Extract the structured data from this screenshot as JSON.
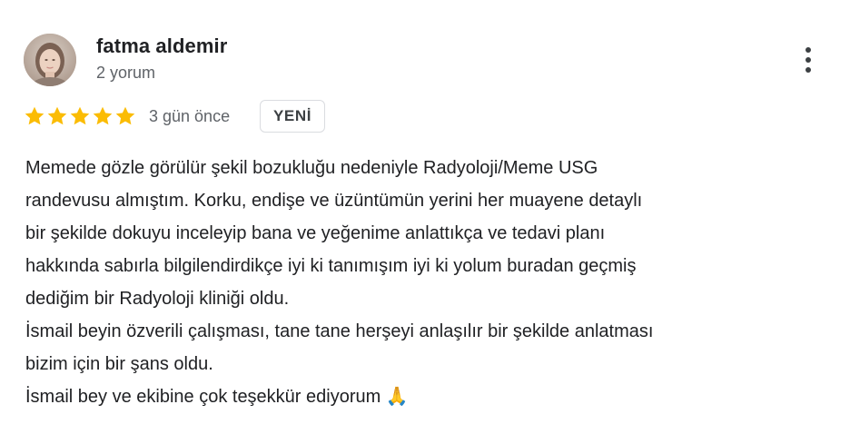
{
  "reviewer": {
    "name": "fatma aldemir",
    "review_count": "2 yorum"
  },
  "rating": {
    "stars": 5,
    "max_stars": 5,
    "star_color": "#fbbc04",
    "date": "3 gün önce",
    "badge": "YENİ"
  },
  "review": {
    "lines": [
      "Memede gözle görülür şekil bozukluğu nedeniyle Radyoloji/Meme USG",
      "randevusu almıştım. Korku, endişe ve üzüntümün yerini her muayene detaylı",
      "bir şekilde dokuyu inceleyip bana ve yeğenime anlattıkça ve tedavi planı",
      "hakkında sabırla bilgilendirdikçe iyi ki tanımışım iyi ki yolum buradan geçmiş",
      "dediğim bir Radyoloji kliniği oldu.",
      "İsmail beyin özverili çalışması, tane tane herşeyi anlaşılır bir şekilde anlatması",
      "bizim için bir şans oldu.",
      "İsmail bey ve ekibine çok teşekkür ediyorum 🙏"
    ]
  },
  "icons": {
    "avatar": "profile-photo",
    "more": "more-vertical-icon",
    "star": "star-icon"
  }
}
